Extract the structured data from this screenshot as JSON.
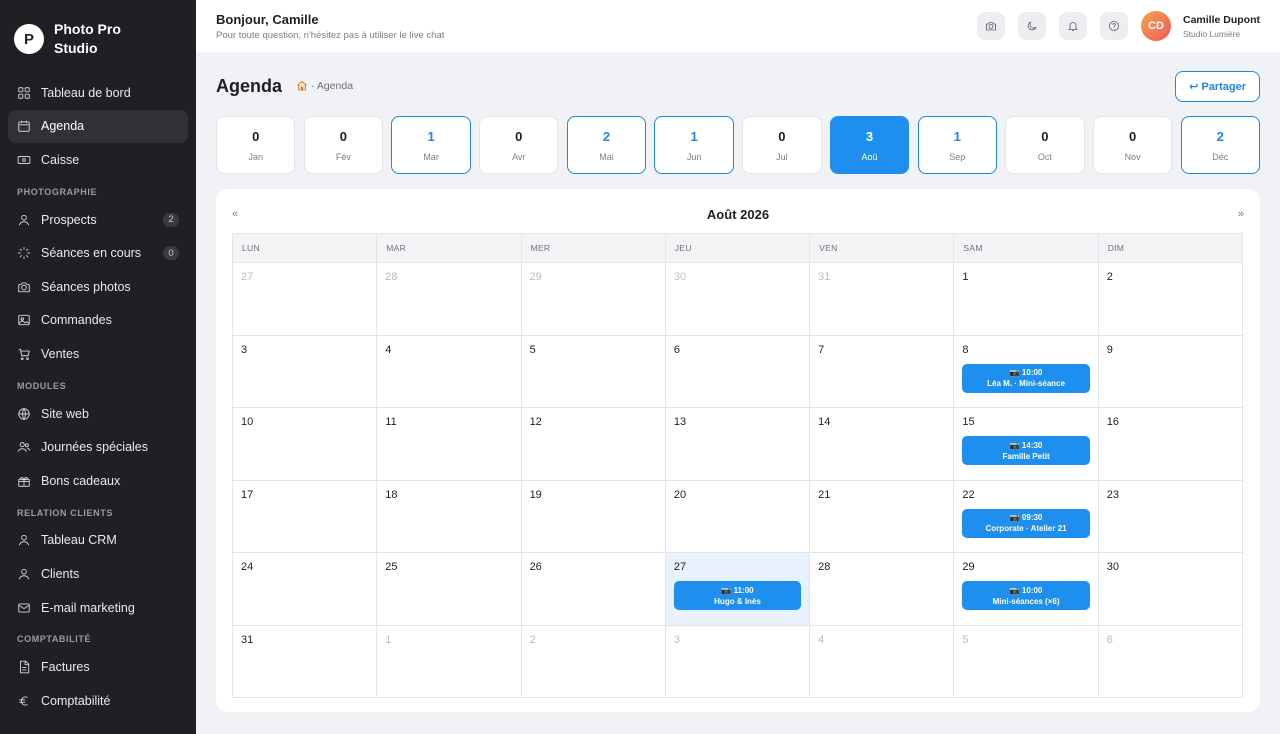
{
  "brand": {
    "logo_letter": "P",
    "name": "Photo Pro Studio"
  },
  "sidebar": {
    "top_items": [
      {
        "label": "Tableau de bord",
        "icon": "grid-icon"
      },
      {
        "label": "Agenda",
        "icon": "calendar-icon",
        "active": true
      },
      {
        "label": "Caisse",
        "icon": "cash-icon"
      }
    ],
    "sections": [
      {
        "title": "PHOTOGRAPHIE",
        "items": [
          {
            "label": "Prospects",
            "icon": "user-icon",
            "badge": "2"
          },
          {
            "label": "Séances en cours",
            "icon": "spinner-icon",
            "badge": "0"
          },
          {
            "label": "Séances photos",
            "icon": "camera-icon"
          },
          {
            "label": "Commandes",
            "icon": "image-icon"
          },
          {
            "label": "Ventes",
            "icon": "cart-icon"
          }
        ]
      },
      {
        "title": "MODULES",
        "items": [
          {
            "label": "Site web",
            "icon": "globe-icon"
          },
          {
            "label": "Journées spéciales",
            "icon": "users-icon"
          },
          {
            "label": "Bons cadeaux",
            "icon": "gift-icon"
          }
        ]
      },
      {
        "title": "RELATION CLIENTS",
        "items": [
          {
            "label": "Tableau CRM",
            "icon": "user-icon"
          },
          {
            "label": "Clients",
            "icon": "user-icon"
          },
          {
            "label": "E-mail marketing",
            "icon": "mail-icon"
          }
        ]
      },
      {
        "title": "COMPTABILITÉ",
        "items": [
          {
            "label": "Factures",
            "icon": "file-icon"
          },
          {
            "label": "Comptabilité",
            "icon": "euro-icon"
          }
        ]
      }
    ]
  },
  "header": {
    "greeting": "Bonjour, Camille",
    "subtitle": "Pour toute question, n'hésitez pas à utiliser le live chat",
    "user_initials": "CD",
    "user_name": "Camille Dupont",
    "user_studio": "Studio Lumière"
  },
  "page": {
    "title": "Agenda",
    "breadcrumb": "· Agenda",
    "share_label": "↩ Partager"
  },
  "months": [
    {
      "name": "Jan",
      "count": "0"
    },
    {
      "name": "Fév",
      "count": "0"
    },
    {
      "name": "Mar",
      "count": "1"
    },
    {
      "name": "Avr",
      "count": "0"
    },
    {
      "name": "Mai",
      "count": "2"
    },
    {
      "name": "Jun",
      "count": "1"
    },
    {
      "name": "Jul",
      "count": "0"
    },
    {
      "name": "Aoû",
      "count": "3",
      "selected": true
    },
    {
      "name": "Sep",
      "count": "1"
    },
    {
      "name": "Oct",
      "count": "0"
    },
    {
      "name": "Nov",
      "count": "0"
    },
    {
      "name": "Déc",
      "count": "2"
    }
  ],
  "calendar": {
    "prev": "«",
    "next": "»",
    "month_label": "Août 2026",
    "weekdays": [
      "LUN",
      "MAR",
      "MER",
      "JEU",
      "VEN",
      "SAM",
      "DIM"
    ],
    "days": [
      {
        "d": "27",
        "out": true
      },
      {
        "d": "28",
        "out": true
      },
      {
        "d": "29",
        "out": true
      },
      {
        "d": "30",
        "out": true
      },
      {
        "d": "31",
        "out": true
      },
      {
        "d": "1"
      },
      {
        "d": "2"
      },
      {
        "d": "3"
      },
      {
        "d": "4"
      },
      {
        "d": "5"
      },
      {
        "d": "6"
      },
      {
        "d": "7"
      },
      {
        "d": "8",
        "event": {
          "time": "📷 10:00",
          "title": "Léa M. · Mini-séance"
        }
      },
      {
        "d": "9"
      },
      {
        "d": "10"
      },
      {
        "d": "11"
      },
      {
        "d": "12"
      },
      {
        "d": "13"
      },
      {
        "d": "14"
      },
      {
        "d": "15",
        "event": {
          "time": "📷 14:30",
          "title": "Famille Petit"
        }
      },
      {
        "d": "16"
      },
      {
        "d": "17"
      },
      {
        "d": "18"
      },
      {
        "d": "19"
      },
      {
        "d": "20"
      },
      {
        "d": "21"
      },
      {
        "d": "22",
        "event": {
          "time": "📷 09:30",
          "title": "Corporate · Atelier 21"
        }
      },
      {
        "d": "23"
      },
      {
        "d": "24"
      },
      {
        "d": "25"
      },
      {
        "d": "26"
      },
      {
        "d": "27",
        "today": true,
        "event": {
          "time": "📷 11:00",
          "title": "Hugo & Inès"
        }
      },
      {
        "d": "28"
      },
      {
        "d": "29",
        "event": {
          "time": "📷 10:00",
          "title": "Mini-séances (×6)"
        }
      },
      {
        "d": "30"
      },
      {
        "d": "31"
      },
      {
        "d": "1",
        "out": true
      },
      {
        "d": "2",
        "out": true
      },
      {
        "d": "3",
        "out": true
      },
      {
        "d": "4",
        "out": true
      },
      {
        "d": "5",
        "out": true
      },
      {
        "d": "6",
        "out": true
      }
    ]
  },
  "colors": {
    "accent": "#1e8fef",
    "sidebar": "#1f2024",
    "today": "#e7f2fd"
  }
}
